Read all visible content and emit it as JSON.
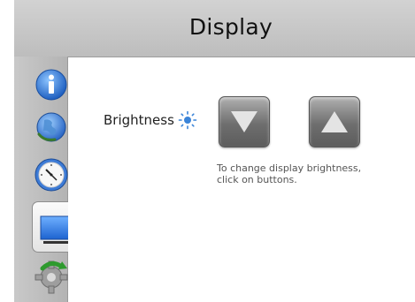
{
  "header": {
    "title": "Display"
  },
  "sidebar": {
    "items": [
      {
        "name": "info-icon"
      },
      {
        "name": "globe-icon"
      },
      {
        "name": "clock-icon"
      },
      {
        "name": "monitor-icon",
        "active": true
      },
      {
        "name": "gear-refresh-icon"
      }
    ]
  },
  "display": {
    "brightness_label": "Brightness",
    "hint_line1": "To change display brightness,",
    "hint_line2": "click on buttons."
  },
  "colors": {
    "header_bg": "#c8c8c8",
    "sidebar_bg": "#bdbdbd",
    "button_gray": "#777777",
    "accent_blue": "#3a84d8"
  }
}
